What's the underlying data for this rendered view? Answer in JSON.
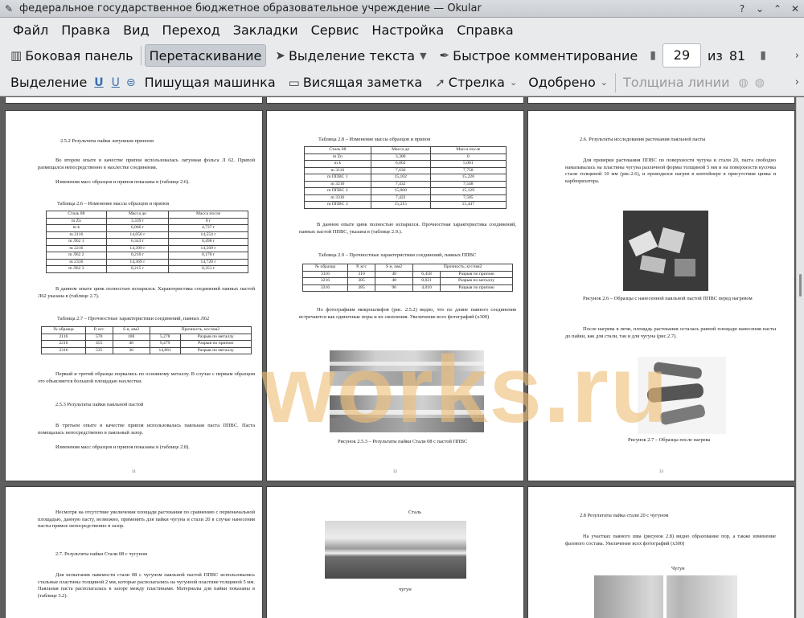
{
  "window": {
    "title": "федеральное государственное бюджетное образовательное учреждение  — Okular"
  },
  "menu": [
    "Файл",
    "Правка",
    "Вид",
    "Переход",
    "Закладки",
    "Сервис",
    "Настройка",
    "Справка"
  ],
  "toolbar1": {
    "sidebar": "Боковая панель",
    "drag": "Перетаскивание",
    "text_select": "Выделение текста",
    "quick_comment": "Быстрое комментирование",
    "page_current": "29",
    "page_of": "из",
    "page_total": "81"
  },
  "toolbar2": {
    "select": "Выделение",
    "typewriter": "Пишущая машинка",
    "note": "Висящая заметка",
    "arrow": "Стрелка",
    "approved": "Одобрено",
    "line_width": "Толщина линии"
  },
  "watermark": "works.ru",
  "pages": {
    "p31": {
      "h1": "2.5.2 Результаты пайки латунным припоем",
      "para1": "Во втором опыте в качестве припоя использовалась латунная фольга Л 62. Припой размещался непосредственно в нахлестке соединения.",
      "para2": "Изменения масс образцов и припоя показаны в (таблице 2.6).",
      "t26cap": "Таблица 2.6 – Изменение массы образцов и припоя",
      "t26head": [
        "Сталь 08",
        "Масса до",
        "Масса после"
      ],
      "t26rows": [
        [
          "m Zn",
          "3,339 г",
          "0 г"
        ],
        [
          "m k",
          "6,066 г",
          "4,737 г"
        ],
        [
          "m 2116",
          "14,056 г",
          "14,554 г"
        ],
        [
          "m Л62 1",
          "0,343 г",
          "0,498 г"
        ],
        [
          "m 2216",
          "14,399 г",
          "14,569 г"
        ],
        [
          "m Л62 2",
          "0,210 г",
          "0,170 г"
        ],
        [
          "m 2316",
          "14,369 г",
          "14,720 г"
        ],
        [
          "m Л62 3",
          "0,215 г",
          "0,351 г"
        ]
      ],
      "para3": "В данном опыте цинк полностью испарился. Характеристика соединений паяных пастой Л62 указана в (таблице 2.7).",
      "t27cap": "Таблица 2.7 – Прочностные характеристики соединений, паяных Л62",
      "t27head": [
        "№ образца",
        "P, кгс",
        "S н, мм2",
        "Прочность, кгс/мм2",
        ""
      ],
      "t27rows": [
        [
          "2116",
          "570",
          "108",
          "5,278",
          "Разрыв по металлу"
        ],
        [
          "2216",
          "455",
          "48",
          "9,479",
          "Разрыв по припою"
        ],
        [
          "2316",
          "535",
          "36",
          "14,861",
          "Разрыв по металлу"
        ]
      ],
      "para4": "Первый и третий образцы порвались по основному металлу. В случае с первым образцом это объясняется большой площадью нахлестки.",
      "h2": "2.5.3 Результаты пайки паяльной пастой",
      "para5": "В третьем опыте в качестве припоя использовалась паяльная паста ППВС. Паста помещалась непосредственно в паяльный зазор.",
      "para6": "Изменения масс образцов и припоя показаны в (таблице 2.8).",
      "num": "31"
    },
    "p32": {
      "t28cap": "Таблица 2.8 – Изменение массы образцов и припоя",
      "t28head": [
        "Сталь 08",
        "Масса до",
        "Масса после"
      ],
      "t28rows": [
        [
          "m Zn",
          "3,300",
          "0"
        ],
        [
          "m k",
          "6,002",
          "5,081"
        ],
        [
          "m 3116",
          "7,636",
          "7,758"
        ],
        [
          "m ППВС 1",
          "15,102",
          "15,226"
        ],
        [
          "m 3216",
          "7,432",
          "7,548"
        ],
        [
          "m ППВС 2",
          "15,060",
          "15,129"
        ],
        [
          "m 3316",
          "7,422",
          "7,585"
        ],
        [
          "m ППВС 3",
          "15,215",
          "15,447"
        ]
      ],
      "para1": "В данном опыте цинк полностью испарился. Прочностная характеристика соединений, паяных пастой ППВС, указана в (таблице 2.9.).",
      "t29cap": "Таблица 2.9 – Прочностные характеристики соединений, паяных ППВС",
      "t29head": [
        "№ образца",
        "P, кгс",
        "S н, мм2",
        "Прочность, кгс/мм2",
        ""
      ],
      "t29rows": [
        [
          "3116",
          "310",
          "48",
          "6,458",
          "Разрыв по припою"
        ],
        [
          "3216",
          "385",
          "48",
          "8,021",
          "Разрыв по металлу"
        ],
        [
          "3316",
          "385",
          "96",
          "4,010",
          "Разрыв по припою"
        ]
      ],
      "para2": "По фотографиям микрошлифов (рис. 2.5.2) видно, что по длине паяного соединения встречаются как одиночные поры и их скопления. Увеличение всех фотографий (x300)",
      "figcap": "Рисунок 2.5.3 – Результаты пайки Стали 08 с пастой ППВС",
      "num": "32"
    },
    "p33": {
      "h1": "2.6. Результаты исследования растекания паяльной пасты",
      "para1": "Для проверки растекания ППВС по поверхности чугуна и стали 20, паста свободно намазывалась на пластины чугуна различной формы толщиной 5 мм и на поверхности кусочка стали толщиной 10 мм (рис.2.6), и проводился нагрев в контейнере в присутствии цинка и карбюризатора.",
      "fig1cap": "Рисунок 2.6 – Образцы с нанесенной паяльной пастой ППВС перед нагревом",
      "para2": "После нагрева в печи, площадь растекания осталась равной площади нанесения пасты до пайки, как для стали, так и для чугуна (рис.2.7).",
      "fig2cap": "Рисунок 2.7 – Образцы после нагрева",
      "num": "33"
    },
    "p34": {
      "para1": "Несмотря на отсутствие увеличения площади растекания по сравнению с первоначальной площадью, данную пасту, возможно, применить для пайки чугуна и стали 20 в случае нанесения пасты прямое непосредственно в зазор.",
      "h1": "2.7. Результаты пайки Стали 08 с чугуном",
      "para2": "Для испытания паяемости стали 08 с чугуном паяльной пастой ППВС использовались стальные пластины толщиной 2 мм, которые располагались на чугунной пластине толщиной 5 мм. Паяльная паста располагалась в зазоре между пластинами. Материалы для пайки показаны в (таблице 3.2)."
    },
    "p35": {
      "top": "Сталь",
      "bottom": "чугун"
    },
    "p36": {
      "h1": "2.8 Результаты пайка стали 20 с чугуном",
      "para1": "На участках паяного шва (рисунок 2.8) видно образование пор, а также изменение фазового состава. Увеличение всех фотографий (x300)",
      "label": "Чугун"
    }
  }
}
